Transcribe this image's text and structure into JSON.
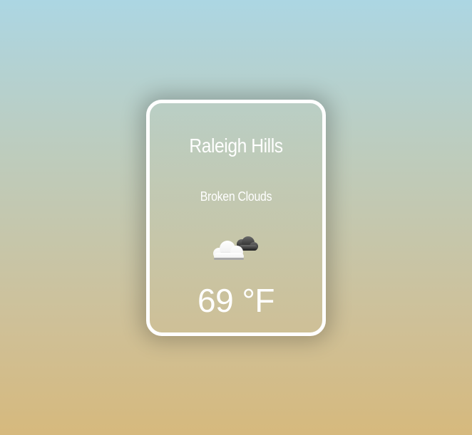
{
  "weather": {
    "city": "Raleigh Hills",
    "description": "Broken Clouds",
    "icon": "broken-clouds-icon",
    "temperature": "69 °F"
  }
}
